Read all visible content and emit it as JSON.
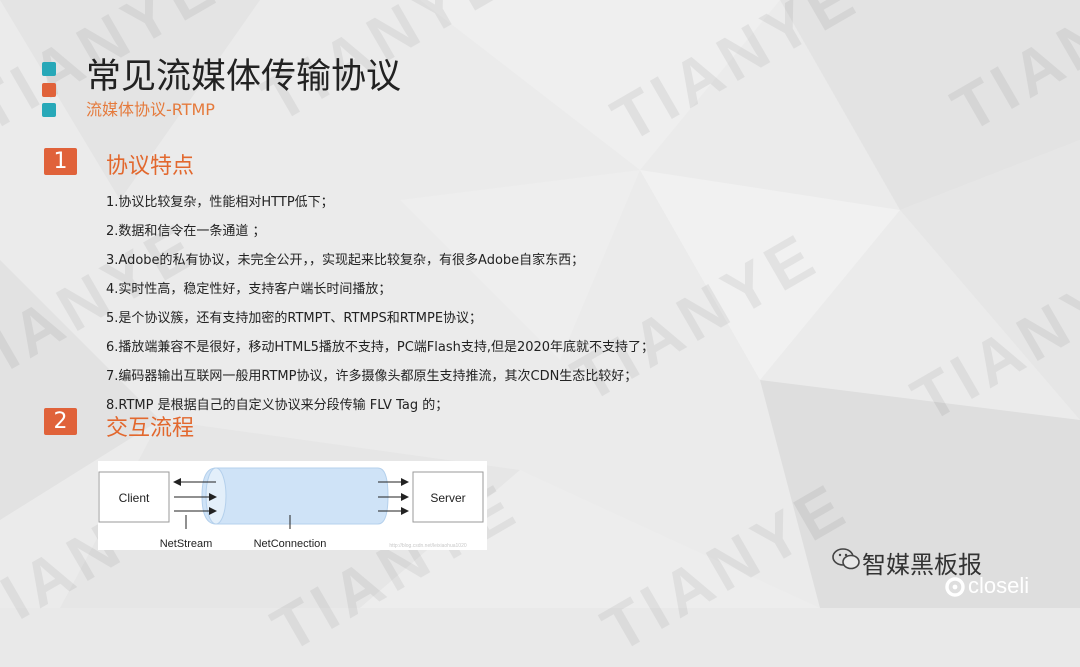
{
  "slide": {
    "title": "常见流媒体传输协议",
    "subtitle": "流媒体协议-RTMP",
    "watermark": "TIANYE"
  },
  "sections": [
    {
      "number": "1",
      "heading": "协议特点"
    },
    {
      "number": "2",
      "heading": "交互流程"
    }
  ],
  "features": [
    "1.协议比较复杂，性能相对HTTP低下；",
    "2.数据和信令在一条通道 ；",
    "3.Adobe的私有协议，未完全公开，，实现起来比较复杂，有很多Adobe自家东西；",
    "4.实时性高，稳定性好，支持客户端长时间播放；",
    "5.是个协议簇，还有支持加密的RTMPT、RTMPS和RTMPE协议；",
    "6.播放端兼容不是很好，移动HTML5播放不支持，PC端Flash支持,但是2020年底就不支持了；",
    "7.编码器输出互联网一般用RTMP协议，许多摄像头都原生支持推流，其次CDN生态比较好；",
    "8.RTMP 是根据自己的自定义协议来分段传输 FLV Tag 的；"
  ],
  "diagram": {
    "client": "Client",
    "server": "Server",
    "netstream": "NetStream",
    "netconnection": "NetConnection",
    "url": "http://blog.csdn.net/leixiaohua1020"
  },
  "branding": {
    "wechat": "智媒黑板报",
    "closeli": "closeli"
  },
  "colors": {
    "accent_orange": "#e2682e",
    "accent_teal": "#27a8b8",
    "text_dark": "#222222"
  }
}
